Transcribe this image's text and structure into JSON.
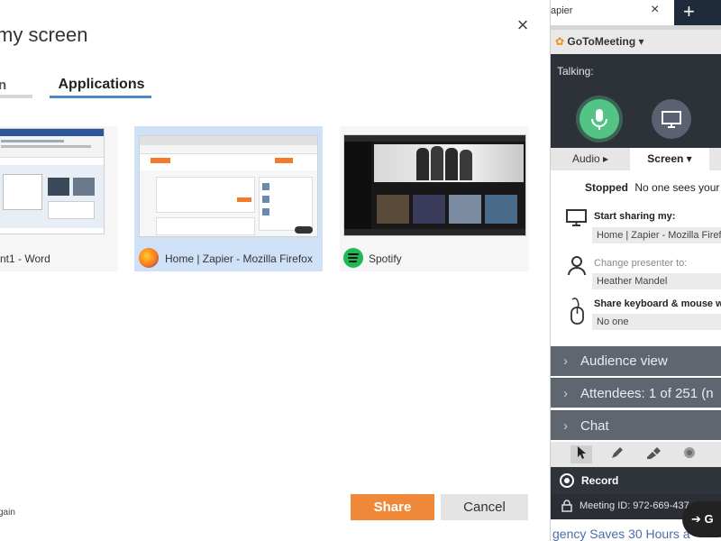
{
  "dialog": {
    "title": "my screen",
    "close_icon": "×",
    "tabs": [
      {
        "label": "n"
      },
      {
        "label": "Applications"
      }
    ],
    "apps": [
      {
        "label": "nt1 - Word",
        "icon": "word-icon"
      },
      {
        "label": "Home | Zapier - Mozilla Firefox",
        "icon": "firefox-icon",
        "selected": true
      },
      {
        "label": "Spotify",
        "icon": "spotify-icon"
      }
    ],
    "share_label": "Share",
    "cancel_label": "Cancel",
    "footer_text": "gain"
  },
  "browser": {
    "tab_title": "apier",
    "tab_close": "×",
    "new_tab": "+"
  },
  "gtm": {
    "logo": "GoToMeeting",
    "talking_label": "Talking:",
    "subtabs": {
      "audio": "Audio ▸",
      "screen": "Screen ▾"
    },
    "stopped_label": "Stopped",
    "stopped_text": "No one sees your",
    "start_sharing_label": "Start sharing my:",
    "start_sharing_value": "Home | Zapier - Mozilla Firefox",
    "change_presenter_label": "Change presenter to:",
    "presenter_value": "Heather Mandel",
    "keyboard_label": "Share keyboard & mouse w",
    "keyboard_value": "No one",
    "sections": [
      "Audience view",
      "Attendees:  1 of 251 (n",
      "Chat"
    ],
    "record_label": "Record",
    "meeting_id": "Meeting ID: 972-669-437",
    "bottom_text": "gency Saves 30 Hours a",
    "pill_text": "G"
  },
  "colors": {
    "share_button": "#f0883a",
    "tab_underline": "#4a86c8",
    "mic_active": "#53c486",
    "panel_dark": "#2d3138",
    "section_bg": "#5f6670"
  }
}
